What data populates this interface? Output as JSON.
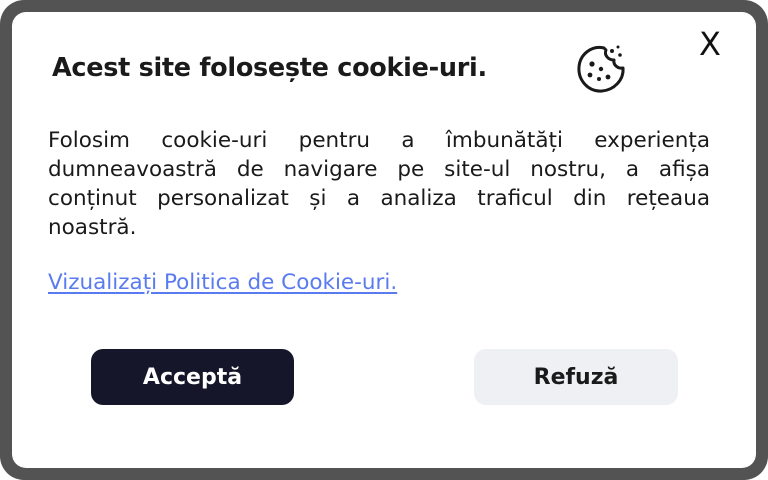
{
  "dialog": {
    "title": "Acest site folosește cookie-uri.",
    "icon": "cookie-icon",
    "close_label": "X",
    "body": "Folosim cookie-uri pentru a îmbunătăți experiența dumneavoastră de navigare pe site-ul nostru, a afișa conținut personalizat și a analiza traficul din rețeaua noastră.",
    "policy_link": "Vizualizați Politica de Cookie-uri.",
    "accept_label": "Acceptă",
    "refuse_label": "Refuză"
  },
  "colors": {
    "frame": "#535353",
    "accept_bg": "#16162a",
    "refuse_bg": "#eef0f3",
    "link": "#5a7bf0"
  }
}
